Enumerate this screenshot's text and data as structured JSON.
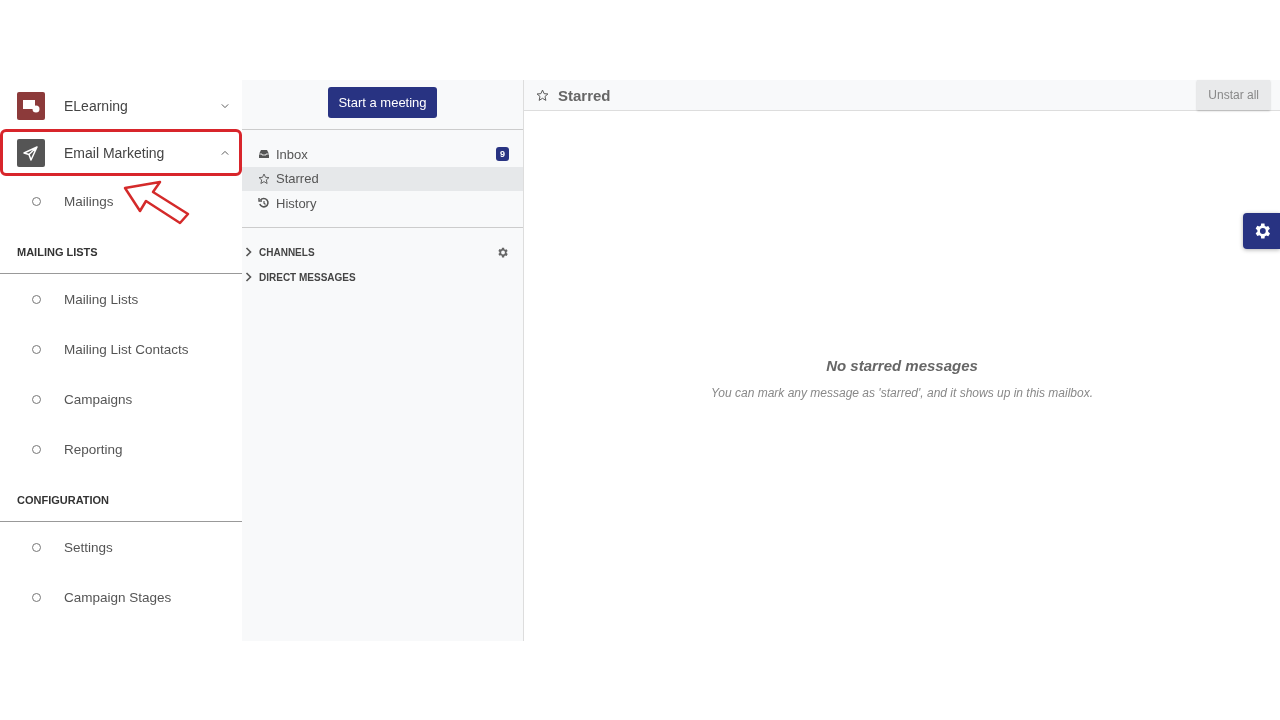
{
  "apps": [
    {
      "label": "ELearning",
      "expanded": false,
      "highlighted": false
    },
    {
      "label": "Email Marketing",
      "expanded": true,
      "highlighted": true
    }
  ],
  "menu": [
    {
      "kind": "item",
      "label": "Mailings"
    },
    {
      "kind": "section",
      "label": "MAILING LISTS"
    },
    {
      "kind": "item",
      "label": "Mailing Lists"
    },
    {
      "kind": "item",
      "label": "Mailing List Contacts"
    },
    {
      "kind": "item",
      "label": "Campaigns"
    },
    {
      "kind": "item",
      "label": "Reporting"
    },
    {
      "kind": "section",
      "label": "CONFIGURATION"
    },
    {
      "kind": "item",
      "label": "Settings"
    },
    {
      "kind": "item",
      "label": "Campaign Stages"
    }
  ],
  "discuss": {
    "button": "Start a meeting",
    "mailboxes": [
      {
        "kind": "inbox",
        "label": "Inbox",
        "badge": "9",
        "selected": false
      },
      {
        "kind": "starred",
        "label": "Starred",
        "selected": true
      },
      {
        "kind": "history",
        "label": "History",
        "selected": false
      }
    ],
    "groups": [
      {
        "label": "CHANNELS",
        "settings": true
      },
      {
        "label": "DIRECT MESSAGES",
        "settings": false
      }
    ]
  },
  "main": {
    "title": "Starred",
    "action": "Unstar all",
    "empty_title": "No starred messages",
    "empty_text": "You can mark any message as 'starred', and it shows up in this mailbox."
  }
}
